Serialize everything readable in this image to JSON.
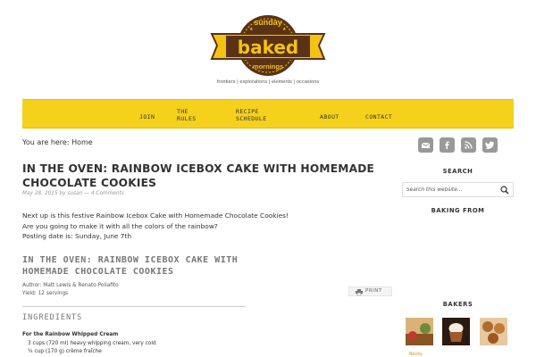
{
  "header": {
    "logo_top": "sunday",
    "logo_main": "baked",
    "logo_bottom": "mornings",
    "tagline": "frontiers | explorations | elements | occasions",
    "colors": {
      "logo_yellow": "#f2c314",
      "logo_brown": "#5b3314",
      "nav_yellow": "#f5d11c"
    }
  },
  "nav": {
    "items": [
      {
        "label": "JOIN"
      },
      {
        "label": "THE RULES"
      },
      {
        "label": "RECIPE SCHEDULE"
      },
      {
        "label": "ABOUT"
      },
      {
        "label": "CONTACT"
      }
    ]
  },
  "breadcrumb": {
    "prefix": "You are here: ",
    "home": "Home"
  },
  "post": {
    "title": "IN THE OVEN: RAINBOW ICEBOX CAKE WITH HOMEMADE CHOCOLATE COOKIES",
    "date": "May 28, 2015",
    "by": "by",
    "author": "susan",
    "separator": "—",
    "comments": "4 Comments",
    "body_lines": [
      "Next up is this festive Rainbow Icebox Cake with Homemade Chocolate Cookies!",
      "Are you going to make it with all the colors of the rainbow?",
      "Posting date is: Sunday, June 7th"
    ]
  },
  "recipe": {
    "title": "IN THE OVEN: RAINBOW ICEBOX CAKE WITH HOMEMADE CHOCOLATE COOKIES",
    "author_line": "Author: Matt Lewis & Renato Poliafito",
    "yield_line": "Yield: 12 servings",
    "print_label": "PRINT",
    "ingredients_heading": "INGREDIENTS",
    "ingredient_subhead": "For the Rainbow Whipped Cream",
    "ingredients": [
      "3 cups (720 ml) heavy whipping cream, very cold",
      "¾ cup (170 g) crème fraîche"
    ]
  },
  "sidebar": {
    "social_icons": [
      "mail-icon",
      "facebook-icon",
      "rss-icon",
      "twitter-icon"
    ],
    "search_title": "SEARCH",
    "search_placeholder": "Search this website…",
    "baking_from_title": "BAKING FROM",
    "bakers_title": "BAKERS",
    "bakers_link": "Becky"
  }
}
